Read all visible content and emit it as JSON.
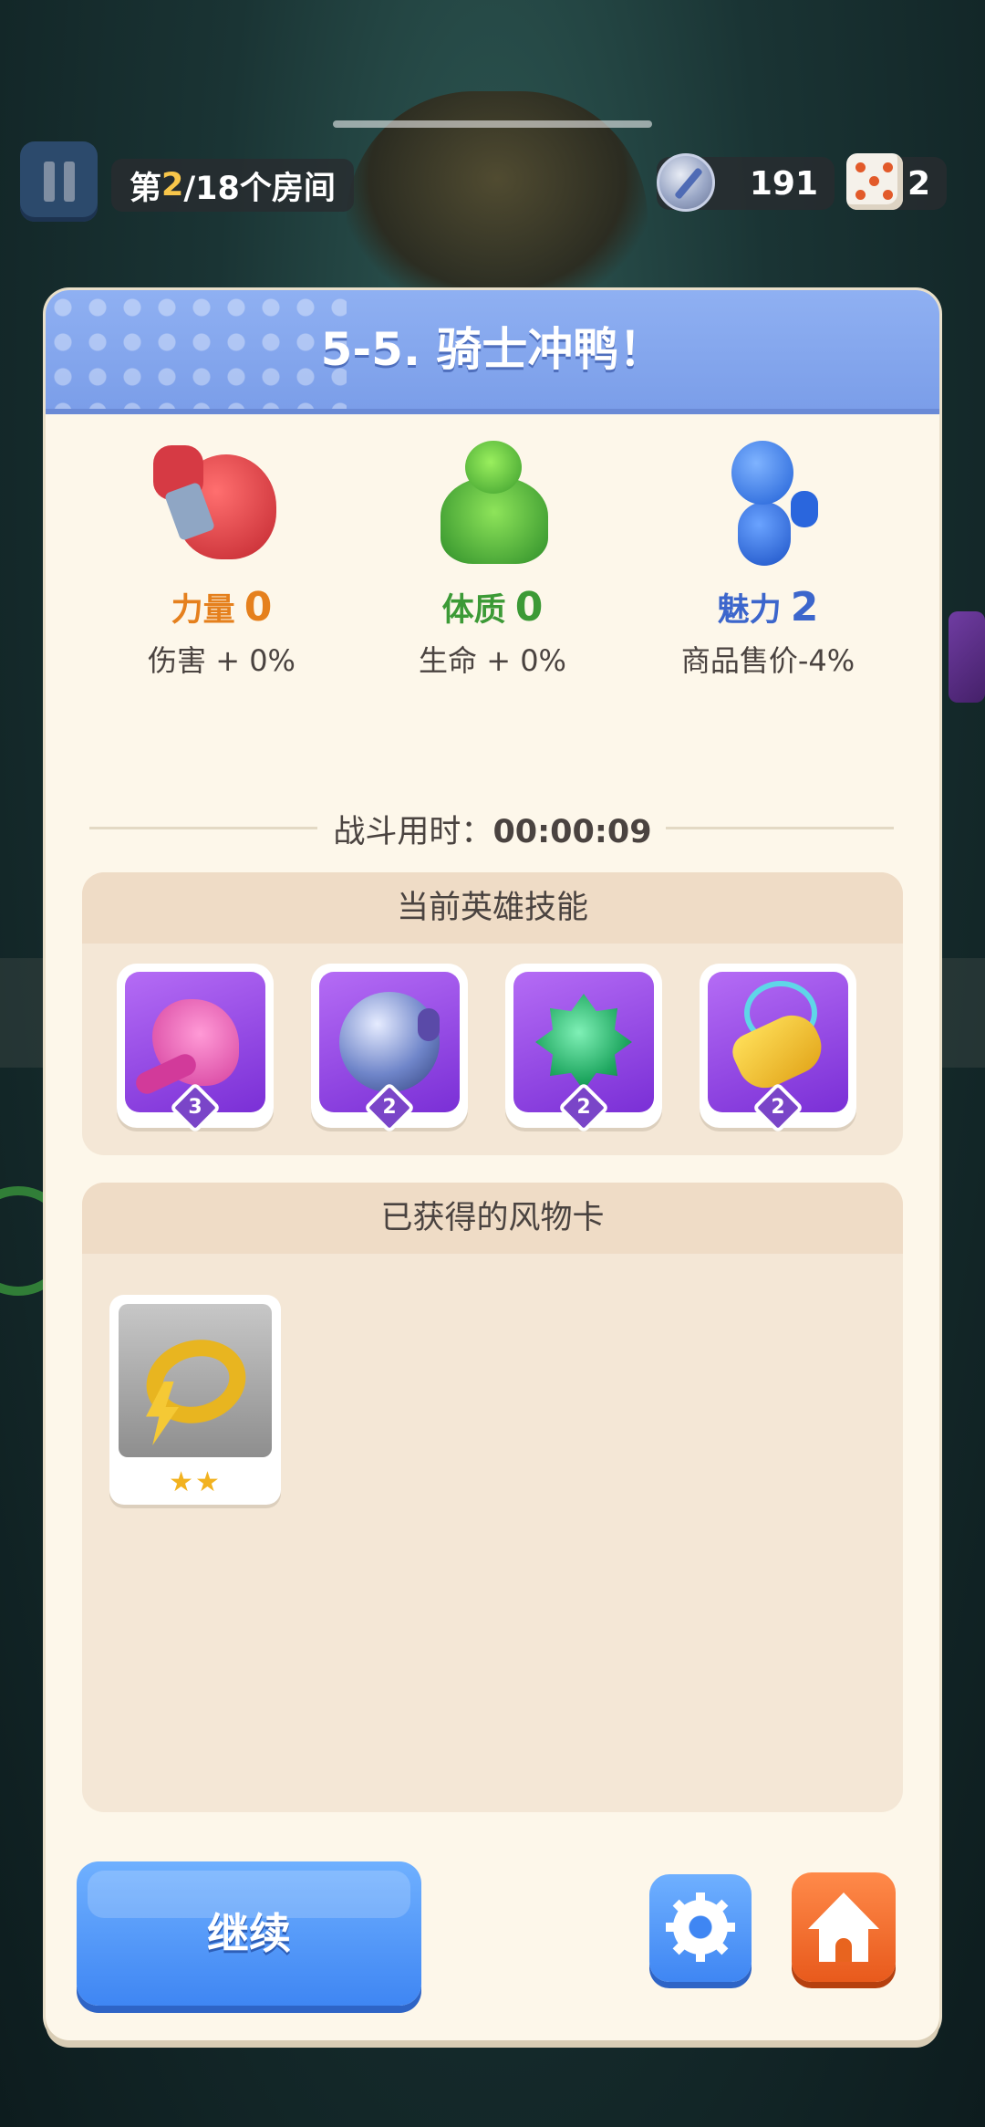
{
  "top_bar": {
    "room_prefix": "第",
    "room_current": "2",
    "room_suffix": "/18个房间",
    "sword_currency": "191",
    "dice_currency": "2"
  },
  "panel": {
    "title": "5-5. 骑士冲鸭！",
    "attributes": [
      {
        "name": "力量",
        "value": "0",
        "desc": "伤害 + 0%",
        "color": "#e5801d"
      },
      {
        "name": "体质",
        "value": "0",
        "desc": "生命 + 0%",
        "color": "#3c9a36"
      },
      {
        "name": "魅力",
        "value": "2",
        "desc": "商品售价-4%",
        "color": "#3c66cc"
      }
    ],
    "battle_time_label": "战斗用时：",
    "battle_time_value": "00:00:09",
    "skills_title": "当前英雄技能",
    "skills": [
      {
        "icon": "pink-dragon-icon",
        "level": "3"
      },
      {
        "icon": "blue-orb-icon",
        "level": "2"
      },
      {
        "icon": "green-gem-icon",
        "level": "2"
      },
      {
        "icon": "golden-whistle-icon",
        "level": "2"
      }
    ],
    "relics_title": "已获得的风物卡",
    "relics": [
      {
        "icon": "golden-ring-icon",
        "stars": "★★"
      }
    ],
    "continue_label": "继续"
  }
}
